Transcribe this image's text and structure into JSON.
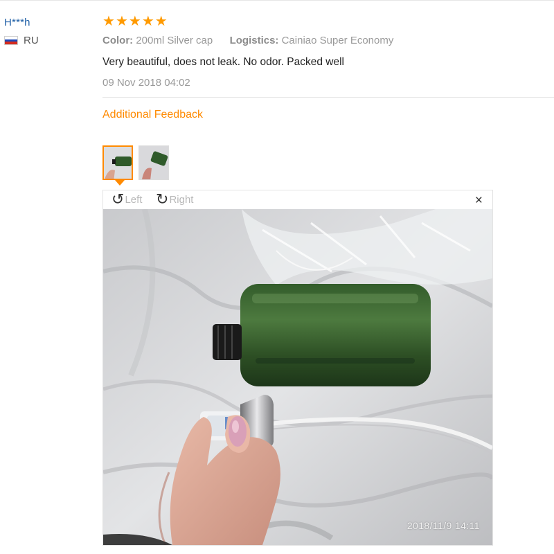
{
  "reviewer": {
    "name": "H***h",
    "country": "RU",
    "flag_colors": [
      "#ffffff",
      "#1c47b8",
      "#d52b1e"
    ]
  },
  "review": {
    "rating": 5,
    "star_color": "#ff9a00",
    "color_label": "Color:",
    "color_value": "200ml Silver cap",
    "logistics_label": "Logistics:",
    "logistics_value": "Cainiao Super Economy",
    "text": "Very beautiful, does not leak. No odor. Packed well",
    "date": "09 Nov 2018 04:02"
  },
  "additional_feedback": {
    "title": "Additional Feedback",
    "accent_color": "#ff8a00"
  },
  "gallery": {
    "thumbnails": [
      {
        "icon": "photo-thumbnail-icon",
        "selected": true
      },
      {
        "icon": "photo-thumbnail-icon",
        "selected": false
      }
    ]
  },
  "viewer": {
    "rotate_left_label": "Left",
    "rotate_right_label": "Right",
    "rotate_left_icon": "rotate-left-icon",
    "rotate_right_icon": "rotate-right-icon",
    "close_icon": "close-icon",
    "close_glyph": "×",
    "photo_timestamp": "2018/11/9  14:11"
  }
}
